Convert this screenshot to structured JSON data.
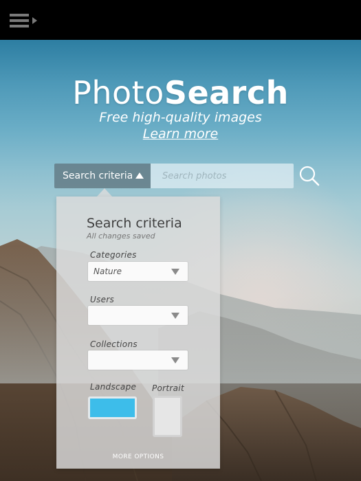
{
  "topbar": {
    "menu_icon": "menu-icon"
  },
  "hero": {
    "title_light": "Photo",
    "title_bold": "Search",
    "subtitle": "Free high-quality images",
    "learn_more": "Learn more"
  },
  "search": {
    "criteria_label": "Search criteria",
    "placeholder": "Search photos",
    "value": "",
    "search_icon": "search-icon"
  },
  "panel": {
    "title": "Search criteria",
    "status": "All changes saved",
    "categories_label": "Categories",
    "categories_value": "Nature",
    "users_label": "Users",
    "users_value": "",
    "collections_label": "Collections",
    "collections_value": "",
    "landscape_label": "Landscape",
    "portrait_label": "Portrait",
    "selected_orientation": "Landscape",
    "more_options": "MORE OPTIONS"
  },
  "colors": {
    "accent": "#3dbdea",
    "topbar": "#000000"
  }
}
